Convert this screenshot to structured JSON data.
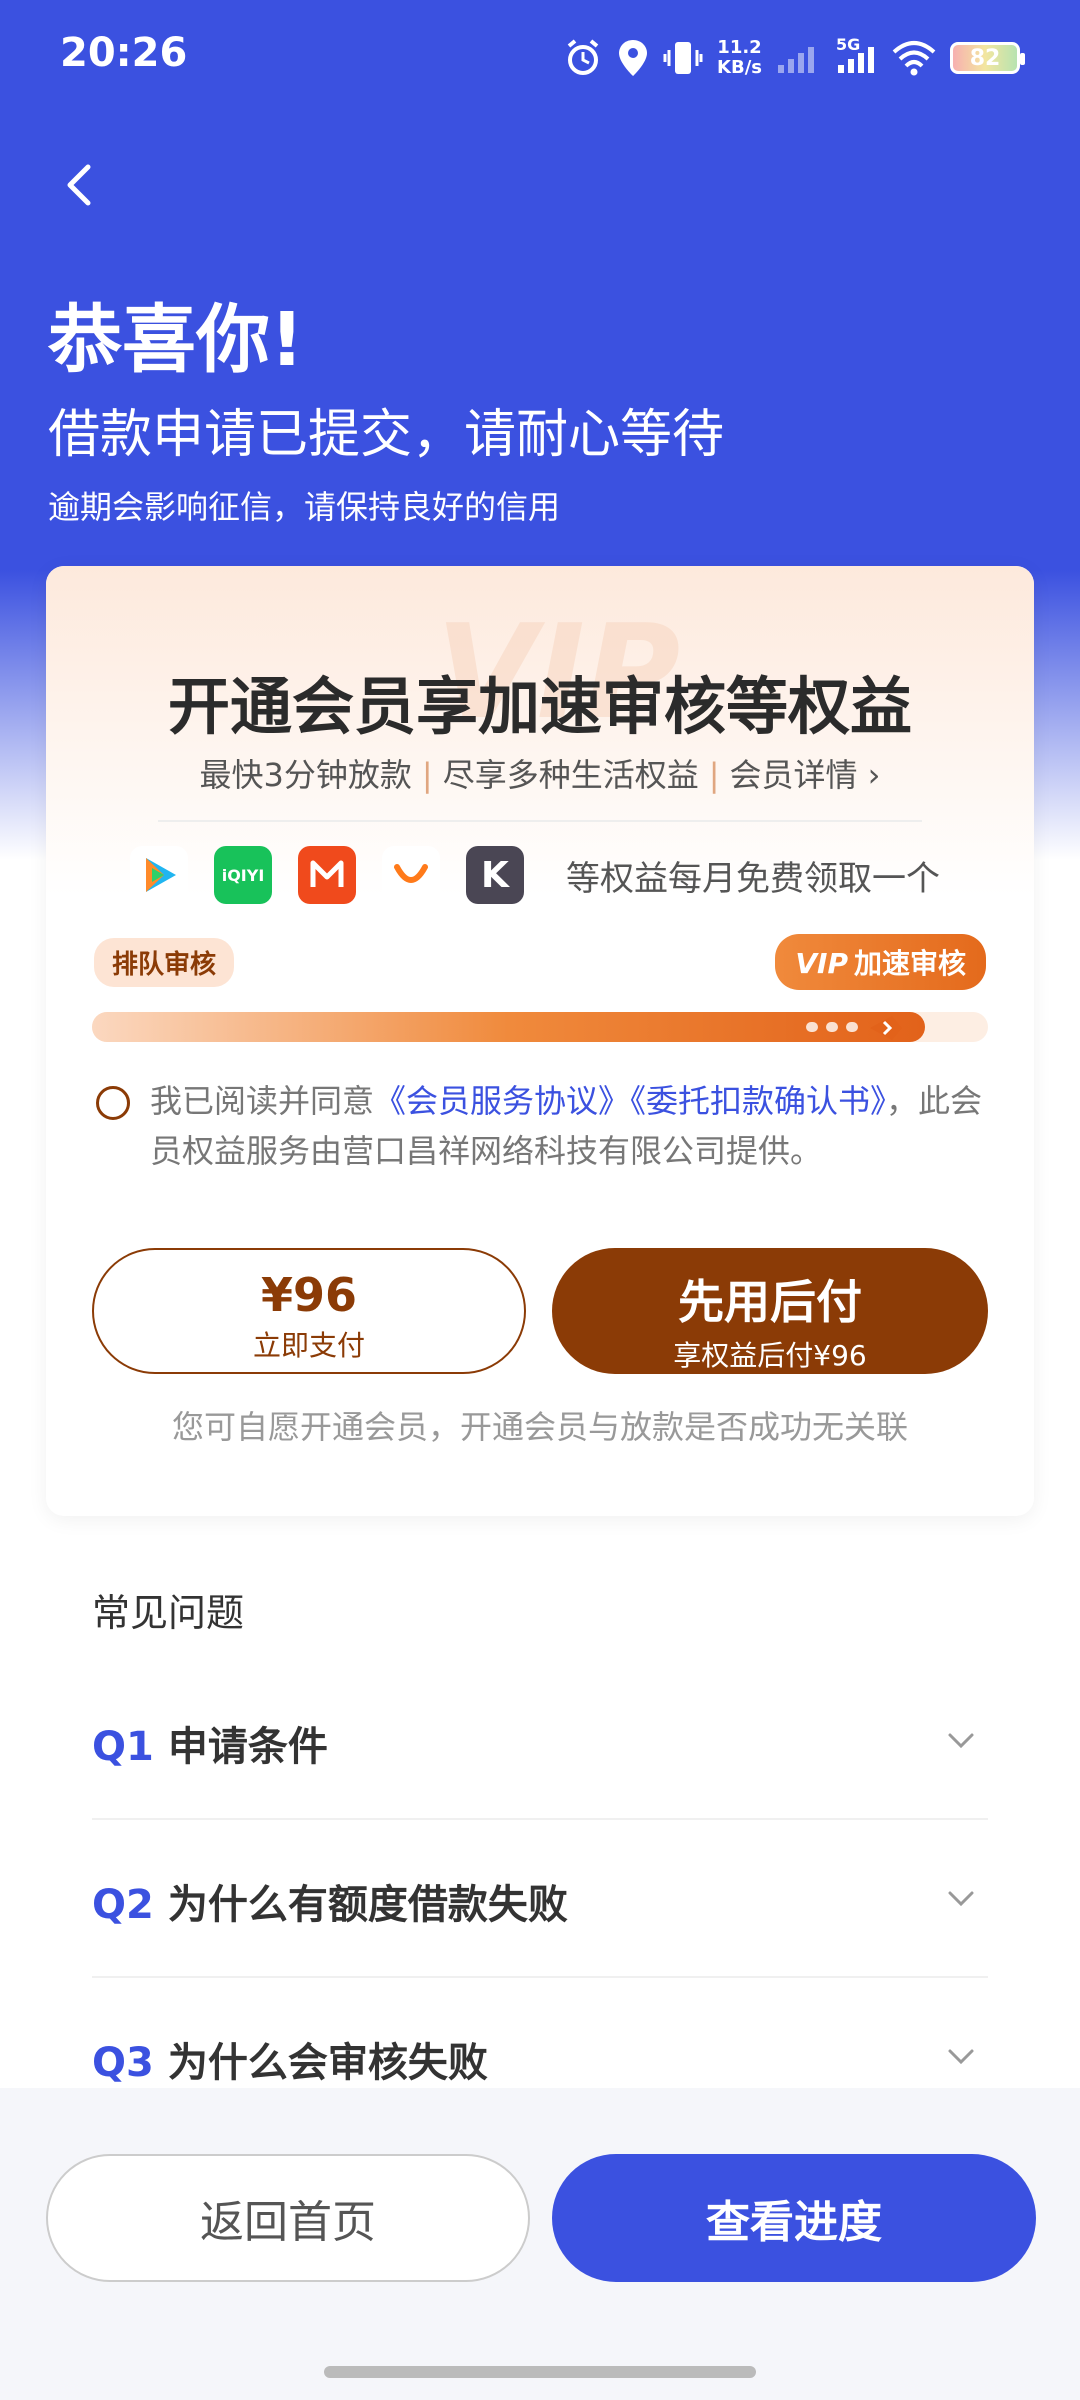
{
  "status_bar": {
    "time": "20:26",
    "net_speed_value": "11.2",
    "net_speed_unit": "KB/s",
    "signal_label": "5G",
    "battery": "82",
    "icons": [
      "alarm-icon",
      "location-icon",
      "vibrate-icon",
      "signal-icon",
      "wifi-icon",
      "battery-icon"
    ]
  },
  "header": {
    "title": "恭喜你!",
    "subtitle": "借款申请已提交，请耐心等待",
    "note": "逾期会影响征信，请保持良好的信用"
  },
  "vip_card": {
    "watermark": "VIP",
    "title": "开通会员享加速审核等权益",
    "perks": [
      "最快3分钟放款",
      "尽享多种生活权益",
      "会员详情"
    ],
    "apps": [
      {
        "name": "tencent-video",
        "color": "#ffffff"
      },
      {
        "name": "iqiyi",
        "label": "iQIYI",
        "color": "#18c25a"
      },
      {
        "name": "mango-tv",
        "color": "#f04a1c"
      },
      {
        "name": "didi",
        "color": "#ffffff"
      },
      {
        "name": "keep",
        "label": "K",
        "color": "#4a4654"
      }
    ],
    "apps_text": "等权益每月免费领取一个",
    "queue_label": "排队审核",
    "vip_logo": "VIP",
    "vip_label": "加速审核",
    "progress": 0.93,
    "agreement_prefix": "我已阅读并同意",
    "agreement_link1": "《会员服务协议》",
    "agreement_link2": "《委托扣款确认书》",
    "agreement_suffix": "，此会员权益服务由营口昌祥网络科技有限公司提供。",
    "pay_now_price": "¥96",
    "pay_now_label": "立即支付",
    "pay_later_title": "先用后付",
    "pay_later_sub": "享权益后付¥96",
    "voluntary_note": "您可自愿开通会员，开通会员与放款是否成功无关联"
  },
  "faq": {
    "title": "常见问题",
    "items": [
      {
        "num": "Q1",
        "question": "申请条件"
      },
      {
        "num": "Q2",
        "question": "为什么有额度借款失败"
      },
      {
        "num": "Q3",
        "question": "为什么会审核失败"
      }
    ]
  },
  "bottom": {
    "home_label": "返回首页",
    "progress_label": "查看进度"
  },
  "colors": {
    "brand_blue": "#3b51e0",
    "vip_brown": "#8b3b06",
    "vip_orange": "#e46a1c"
  }
}
